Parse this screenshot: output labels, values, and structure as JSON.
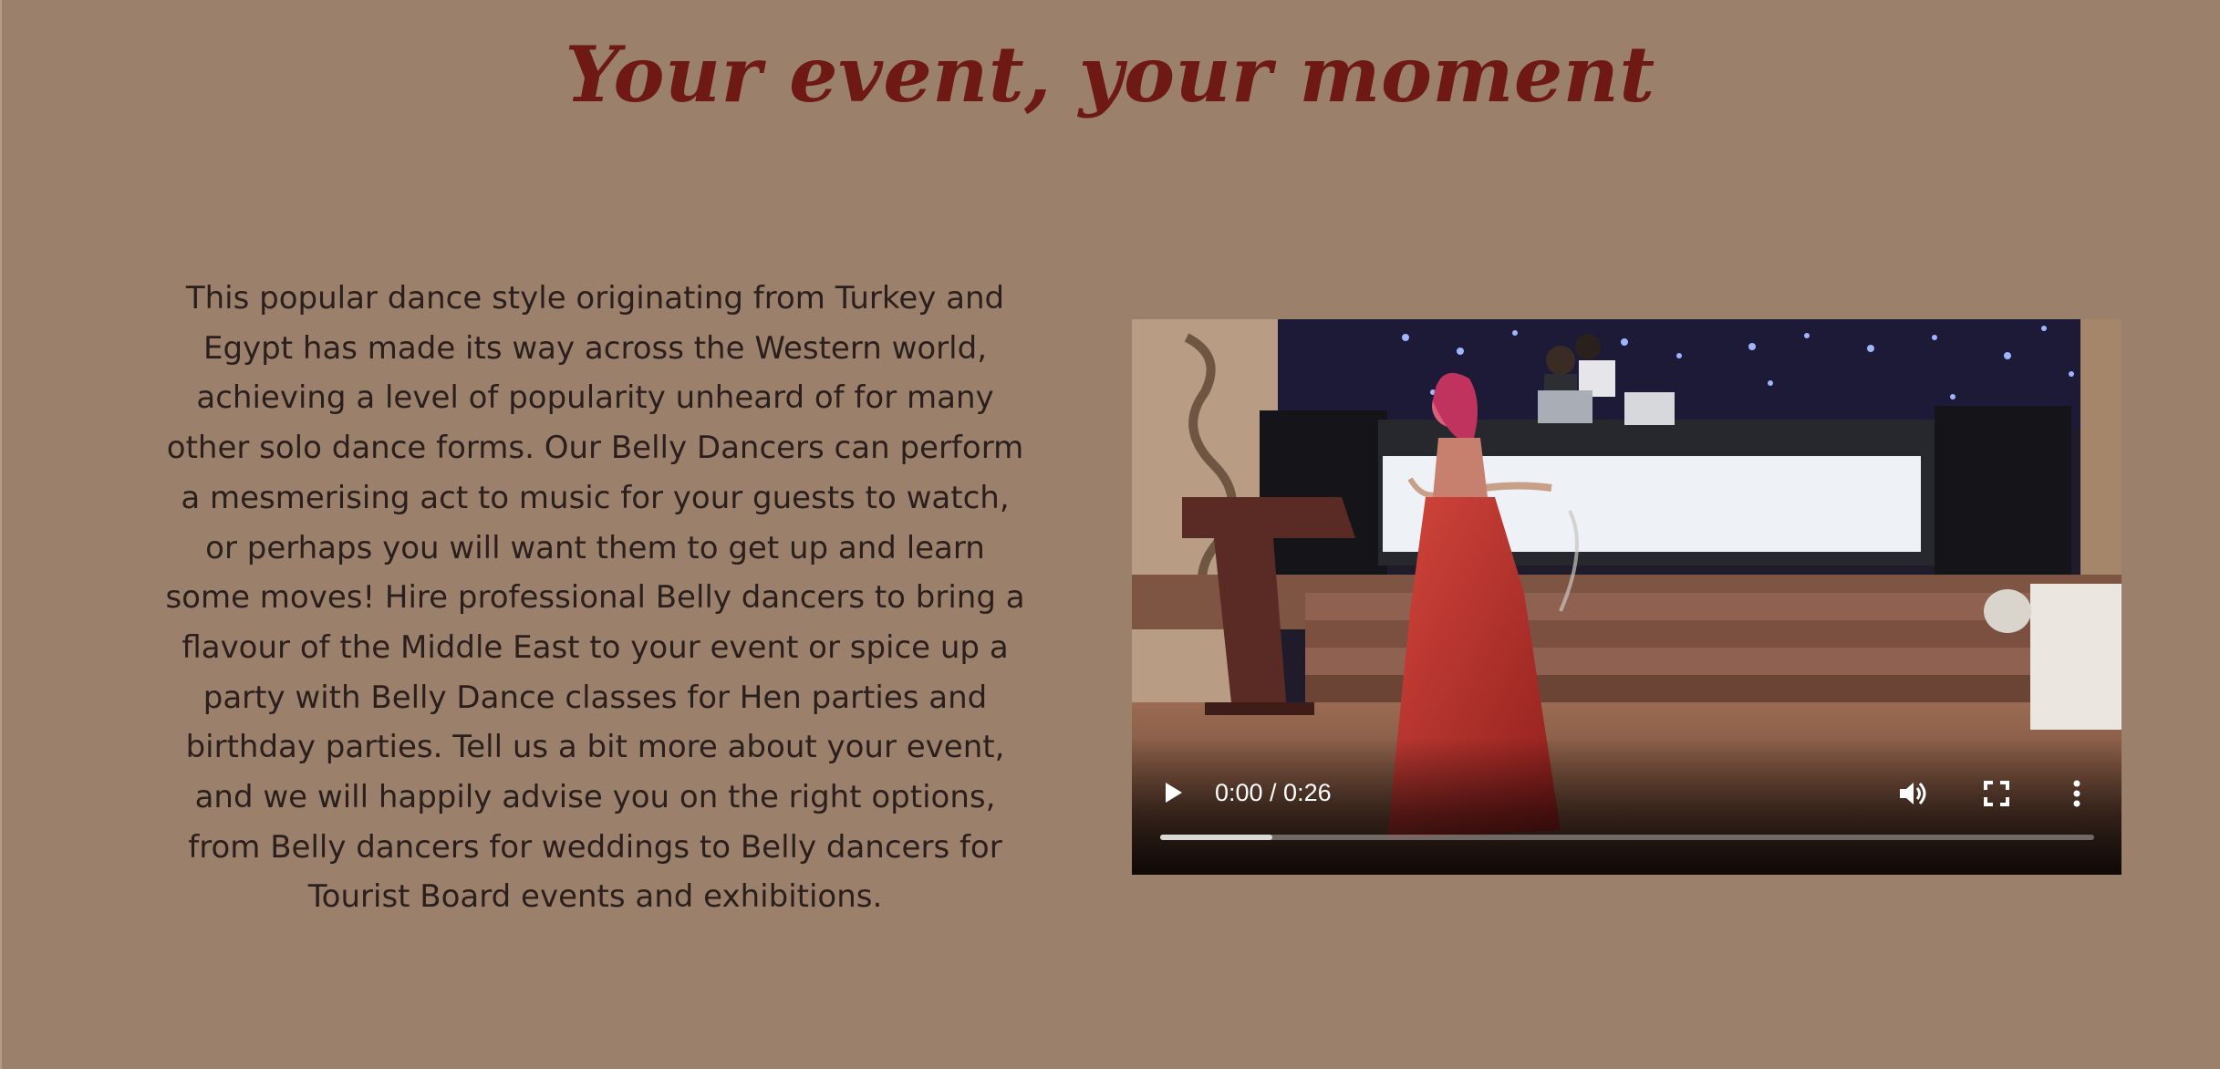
{
  "heading": {
    "title": "Your event, your moment"
  },
  "intro": {
    "paragraph": "This popular dance style originating from Turkey and Egypt has made its way across the Western world, achieving a level of popularity unheard of for many other solo dance forms. Our Belly Dancers can perform a mesmerising act to music for your guests to watch, or perhaps you will want them to get up and learn some moves! Hire professional Belly dancers to bring a flavour of the Middle East to your event or spice up a party with Belly Dance classes for Hen parties and birthday parties. Tell us a bit more about your event, and we will happily advise you on the right options, from Belly dancers for weddings to Belly dancers for Tourist Board events and exhibitions."
  },
  "video": {
    "time_display": "0:00 / 0:26",
    "buffered_fraction": 0.12,
    "icons": {
      "play": "play-icon",
      "volume": "volume-icon",
      "fullscreen": "fullscreen-icon",
      "more": "more-options-icon"
    }
  },
  "colors": {
    "page_background": "#9b816b",
    "title": "#6e1913",
    "body_text": "#2b1f1d"
  }
}
